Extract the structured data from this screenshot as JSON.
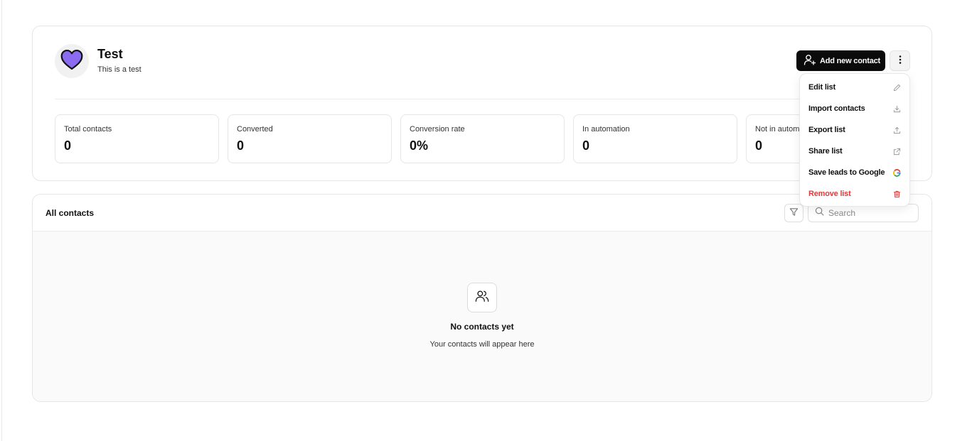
{
  "list": {
    "name": "Test",
    "description": "This is a test",
    "avatar_icon": "heart-icon",
    "avatar_color": "#8b6cf0"
  },
  "header": {
    "add_contact_label": "Add new contact",
    "more_icon": "more-vertical-icon"
  },
  "stats": [
    {
      "label": "Total contacts",
      "value": "0"
    },
    {
      "label": "Converted",
      "value": "0"
    },
    {
      "label": "Conversion rate",
      "value": "0%"
    },
    {
      "label": "In automation",
      "value": "0"
    },
    {
      "label": "Not in automation",
      "value": "0"
    }
  ],
  "contacts": {
    "title": "All contacts",
    "search_placeholder": "Search",
    "empty_title": "No contacts yet",
    "empty_subtitle": "Your contacts will appear here"
  },
  "menu": {
    "items": [
      {
        "label": "Edit list",
        "icon": "pencil-icon"
      },
      {
        "label": "Import contacts",
        "icon": "download-icon"
      },
      {
        "label": "Export list",
        "icon": "upload-icon"
      },
      {
        "label": "Share list",
        "icon": "external-link-icon"
      },
      {
        "label": "Save leads to Google",
        "icon": "google-icon"
      },
      {
        "label": "Remove list",
        "icon": "trash-icon",
        "color": "#e23a3a"
      }
    ]
  }
}
